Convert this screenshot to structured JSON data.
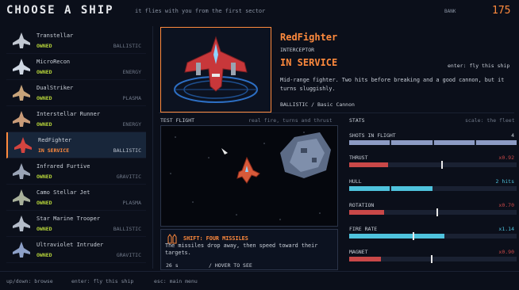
{
  "header": {
    "title": "CHOOSE A SHIP",
    "tagline": "it flies with you from the first sector",
    "bank_label": "BANK",
    "bank_value": "175"
  },
  "ships": [
    {
      "name": "Transtellar",
      "status": "OWNED",
      "type": "BALLISTIC",
      "color": "#c2c8d2"
    },
    {
      "name": "MicroRecon",
      "status": "OWNED",
      "type": "ENERGY",
      "color": "#cfd7e3"
    },
    {
      "name": "DualStriker",
      "status": "OWNED",
      "type": "PLASMA",
      "color": "#c7a37a"
    },
    {
      "name": "Interstellar Runner",
      "status": "OWNED",
      "type": "ENERGY",
      "color": "#c99b78"
    },
    {
      "name": "RedFighter",
      "status": "IN SERVICE",
      "type": "BALLISTIC",
      "color": "#d3443f"
    },
    {
      "name": "Infrared Furtive",
      "status": "OWNED",
      "type": "GRAVITIC",
      "color": "#9aa4b6"
    },
    {
      "name": "Camo Stellar Jet",
      "status": "OWNED",
      "type": "PLASMA",
      "color": "#a8b09a"
    },
    {
      "name": "Star Marine Trooper",
      "status": "OWNED",
      "type": "BALLISTIC",
      "color": "#b4bcc9"
    },
    {
      "name": "Ultraviolet Intruder",
      "status": "OWNED",
      "type": "GRAVITIC",
      "color": "#8da0c8"
    }
  ],
  "detail": {
    "name": "RedFighter",
    "class": "INTERCEPTOR",
    "status": "IN SERVICE",
    "hint": "enter: fly this ship",
    "description": "Mid-range fighter. Two hits before breaking and a good cannon, but it turns sluggishly.",
    "weapon": "BALLISTIC / Basic Cannon"
  },
  "test_flight": {
    "label": "TEST FLIGHT",
    "note": "real fire, turns and thrust"
  },
  "ability": {
    "title": "SHIFT: FOUR MISSILES",
    "description": "The missiles drop away, then speed toward their targets.",
    "time": "26 s",
    "hover": "/   HOVER TO SEE"
  },
  "stats": {
    "label": "STATS",
    "note": "scale: the fleet",
    "items": [
      {
        "name": "SHOTS IN FLIGHT",
        "value": "4",
        "kind": "segments",
        "count": 4,
        "color": "#8d9bc4",
        "value_color": "#c9cfd8"
      },
      {
        "name": "THRUST",
        "value": "x0.92",
        "kind": "bar",
        "fill": 0.23,
        "mark": 0.55,
        "color": "#c94848",
        "value_color": "#c94848"
      },
      {
        "name": "HULL",
        "value": "2 hits",
        "kind": "segments",
        "count": 2,
        "color": "#4fc3dd",
        "value_color": "#4fc3dd"
      },
      {
        "name": "ROTATION",
        "value": "x0.70",
        "kind": "bar",
        "fill": 0.21,
        "mark": 0.52,
        "color": "#c94848",
        "value_color": "#c94848"
      },
      {
        "name": "FIRE RATE",
        "value": "x1.14",
        "kind": "bar",
        "fill": 0.57,
        "mark": 0.38,
        "color": "#4fc3dd",
        "value_color": "#4fc3dd"
      },
      {
        "name": "MAGNET",
        "value": "x0.90",
        "kind": "bar",
        "fill": 0.19,
        "mark": 0.49,
        "color": "#c94848",
        "value_color": "#c94848"
      }
    ]
  },
  "footer": {
    "browse": "up/down: browse",
    "fly": "enter: fly this ship",
    "menu": "esc: main menu"
  }
}
